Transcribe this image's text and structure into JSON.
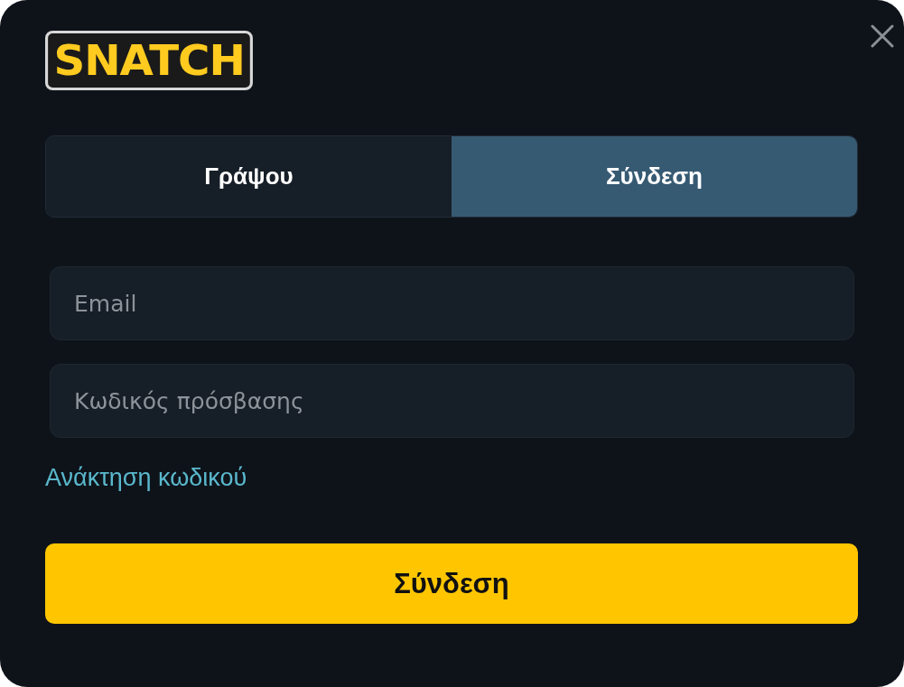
{
  "logo": {
    "text": "SNATCH"
  },
  "tabs": [
    {
      "label": "Γράψου",
      "selected": false
    },
    {
      "label": "Σύνδεση",
      "selected": true
    }
  ],
  "fields": [
    {
      "placeholder": "Email"
    },
    {
      "placeholder": "Κωδικός πρόσβασης"
    }
  ],
  "forgot_link": "Ανάκτηση κωδικού",
  "submit_button": "Σύνδεση"
}
